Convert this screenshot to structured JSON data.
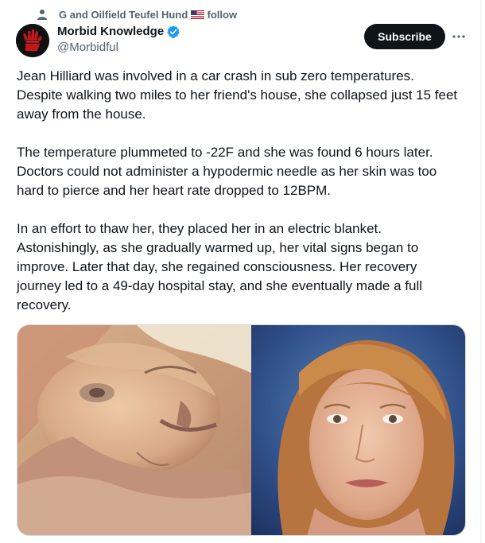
{
  "social_context": {
    "text": "G and Oilfield Teufel Hund",
    "suffix": "follow",
    "flag_icon": "us-flag-icon",
    "person_icon": "person-icon"
  },
  "author": {
    "display_name": "Morbid Knowledge",
    "handle": "@Morbidful",
    "verified_icon": "verified-badge-icon",
    "verified_color": "#1d9bf0",
    "avatar_icon": "red-hand-logo"
  },
  "actions": {
    "subscribe_label": "Subscribe",
    "more_icon": "more-icon"
  },
  "tweet": {
    "paragraphs": [
      "Jean Hilliard was involved in a car crash in sub zero temperatures. Despite walking two miles to her friend's house, she collapsed just 15 feet away from the house.",
      "The temperature plummeted to -22F and she was found 6 hours later. Doctors could not administer a hypodermic needle as her skin was too hard to pierce and her heart rate dropped to 12BPM.",
      "In an effort to thaw her, they placed her in an electric blanket. Astonishingly, as she gradually warmed up, her vital signs began to improve. Later that day, she regained consciousness. Her recovery journey led to a 49-day hospital stay, and she eventually made a full recovery."
    ]
  },
  "media": {
    "left_image": "frozen woman lying in hospital bed photo",
    "right_image": "woman with red hair interview photo"
  },
  "colors": {
    "text_primary": "#0f1419",
    "text_secondary": "#536471",
    "button_bg": "#0f1419",
    "button_text": "#ffffff"
  }
}
